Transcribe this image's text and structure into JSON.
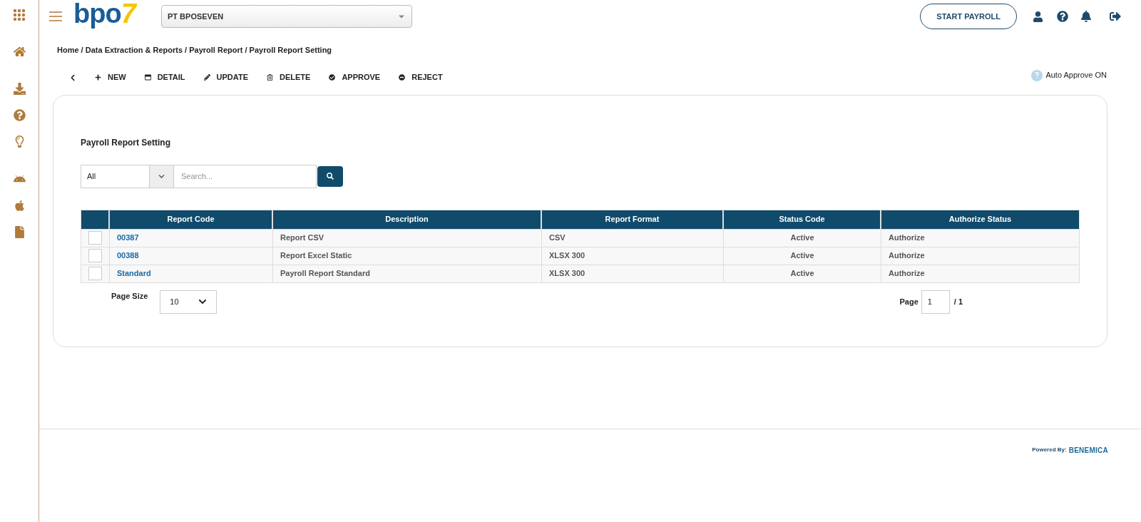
{
  "logo": {
    "text": "bpo",
    "accent": "7"
  },
  "company_select": {
    "value": "PT BPOSEVEN"
  },
  "header": {
    "start_button": "START PAYROLL"
  },
  "breadcrumb": "Home / Data Extraction & Reports / Payroll Report / Payroll Report Setting",
  "toolbar": [
    {
      "kind": "back"
    },
    {
      "kind": "new",
      "label": "NEW"
    },
    {
      "kind": "detail",
      "label": "DETAIL"
    },
    {
      "kind": "update",
      "label": "UPDATE"
    },
    {
      "kind": "delete",
      "label": "DELETE"
    },
    {
      "kind": "approve",
      "label": "APPROVE"
    },
    {
      "kind": "reject",
      "label": "REJECT"
    }
  ],
  "auto_approve": {
    "label": "Auto Approve ON"
  },
  "panel": {
    "title": "Payroll Report Setting",
    "filter": {
      "value": "All"
    },
    "search": {
      "placeholder": "Search..."
    }
  },
  "table": {
    "columns": [
      "Report Code",
      "Description",
      "Report Format",
      "Status Code",
      "Authorize Status"
    ],
    "rows": [
      {
        "checked": false,
        "cells": [
          "00387",
          "Report CSV",
          "CSV",
          "Active",
          "Authorize"
        ]
      },
      {
        "checked": false,
        "cells": [
          "00388",
          "Report Excel Static",
          "XLSX 300",
          "Active",
          "Authorize"
        ]
      },
      {
        "checked": false,
        "cells": [
          "Standard",
          "Payroll Report Standard",
          "XLSX 300",
          "Active",
          "Authorize"
        ]
      }
    ]
  },
  "pagination": {
    "page_size_label": "Page Size",
    "page_size": "10",
    "page_label": "Page",
    "page": "1",
    "total": "/ 1"
  },
  "footer": {
    "powered_by": "Powered By:",
    "brand": "BENEMICA"
  }
}
